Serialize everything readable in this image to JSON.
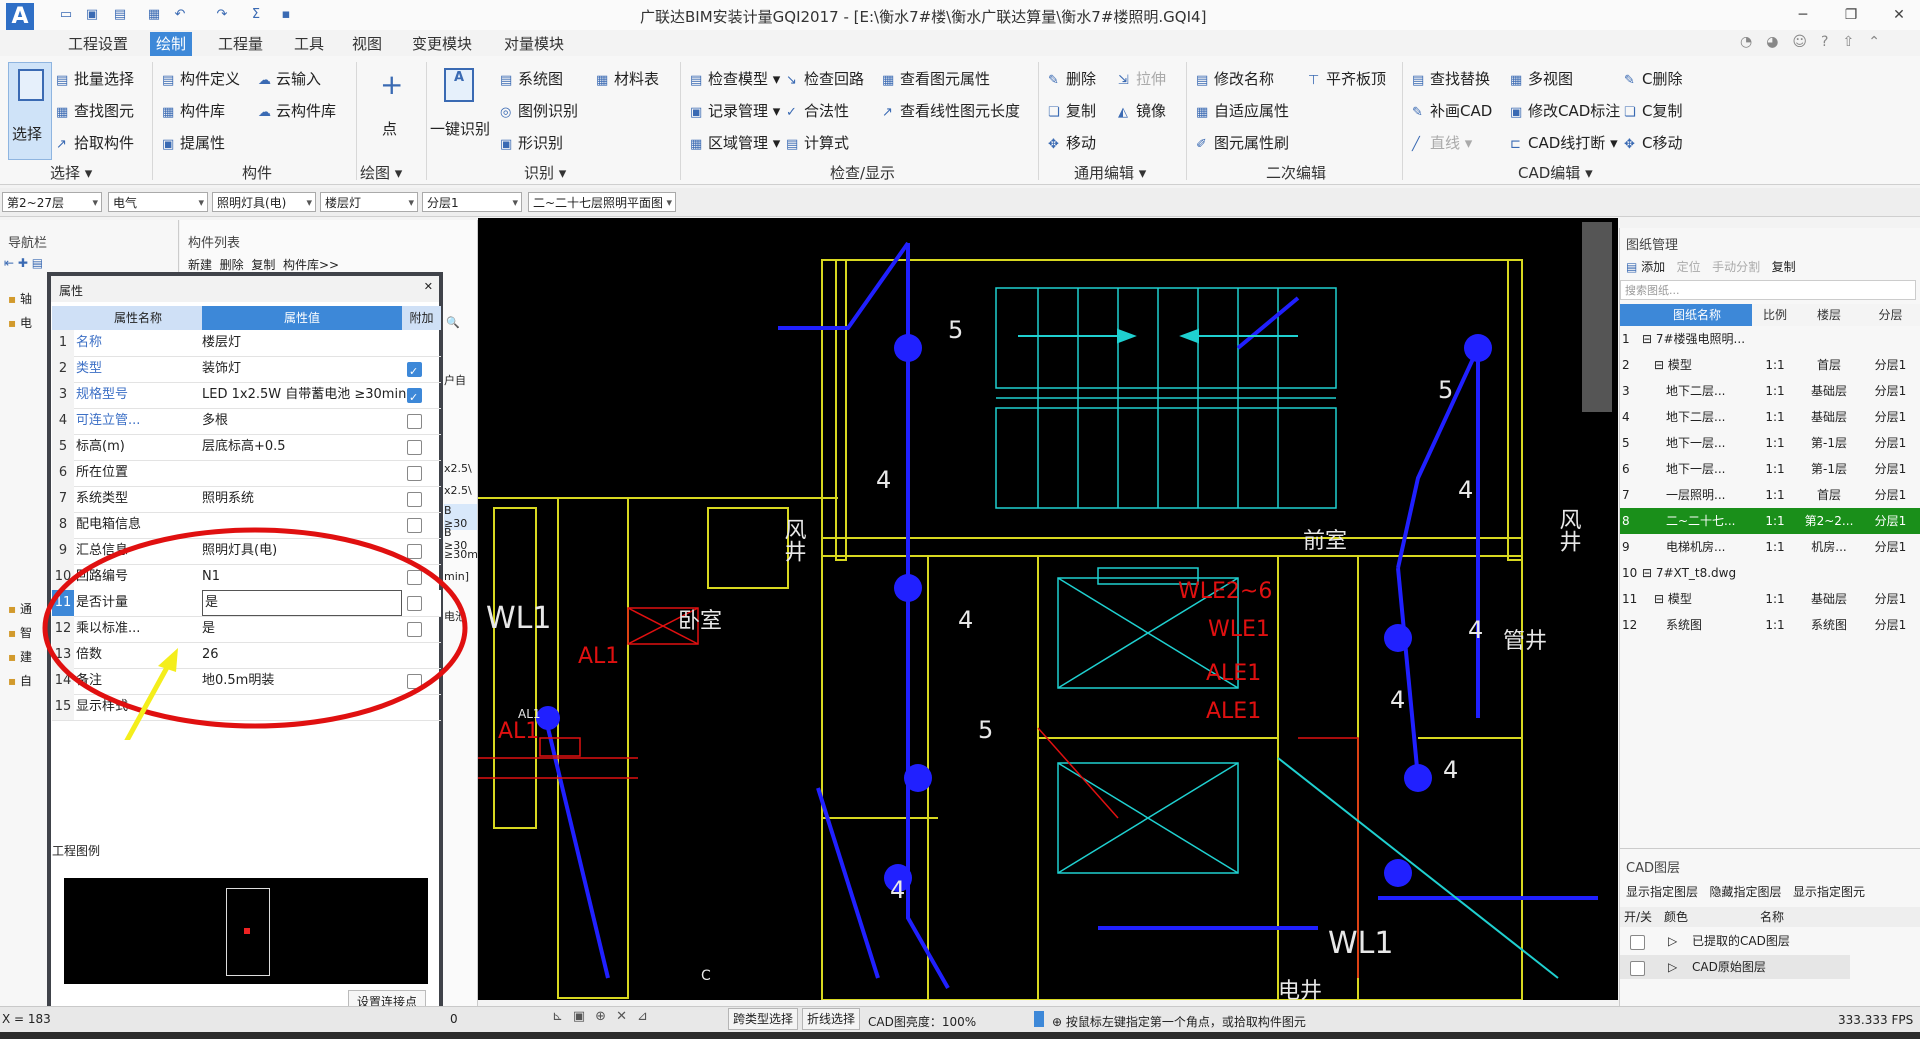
{
  "title": "广联达BIM安装计量GQI2017 - [E:\\衡水7#楼\\衡水广联达算量\\衡水7#楼照明.GQI4]",
  "menu_tabs": [
    "工程设置",
    "绘制",
    "工程量",
    "工具",
    "视图",
    "变更模块",
    "对量模块"
  ],
  "active_tab": "绘制",
  "ribbon": {
    "select_big": "选择",
    "select_items": [
      "批量选择",
      "查找图元",
      "拾取构件"
    ],
    "group_select": "选择",
    "component_items": [
      "构件定义",
      "云输入",
      "构件库",
      "云构件库",
      "提属性"
    ],
    "group_component": "构件",
    "point_label": "点",
    "group_draw": "绘图",
    "one_key": "一键识别",
    "identify_items": [
      "系统图",
      "材料表",
      "图例识别",
      "形识别"
    ],
    "group_identify": "识别",
    "check_items": [
      "检查模型",
      "检查回路",
      "查看图元属性",
      "记录管理",
      "合法性",
      "查看线性图元长度",
      "区域管理",
      "计算式"
    ],
    "group_check": "检查/显示",
    "edit_items": [
      "删除",
      "拉伸",
      "复制",
      "镜像",
      "移动"
    ],
    "group_edit": "通用编辑",
    "edit2_items": [
      "修改名称",
      "平齐板顶",
      "自适应属性",
      "图元属性刷"
    ],
    "group_edit2": "二次编辑",
    "cad_items": [
      "查找替换",
      "多视图",
      "C删除",
      "补画CAD",
      "修改CAD标注",
      "C复制",
      "直线",
      "CAD线打断",
      "C移动"
    ],
    "group_cad": "CAD编辑"
  },
  "selectors": [
    "第2~27层",
    "电气",
    "照明灯具(电)",
    "楼层灯",
    "分层1",
    "二~二十七层照明平面图"
  ],
  "nav": {
    "title": "导航栏",
    "items": [
      "轴",
      "电",
      "通",
      "智",
      "建",
      "自"
    ]
  },
  "complist": {
    "title": "构件列表",
    "toolbar": [
      "新建",
      "删除",
      "复制",
      "构件库>>"
    ],
    "side_texts": [
      "户自",
      "x2.5\\",
      "x2.5\\",
      "B ≥30",
      "B ≥30",
      "≥30m",
      "min]",
      "电池"
    ]
  },
  "property": {
    "title": "属性",
    "headers": [
      "属性名称",
      "属性值",
      "附加"
    ],
    "rows": [
      {
        "n": "1",
        "name": "名称",
        "value": "楼层灯",
        "blue": true,
        "chk": null
      },
      {
        "n": "2",
        "name": "类型",
        "value": "装饰灯",
        "blue": true,
        "chk": true
      },
      {
        "n": "3",
        "name": "规格型号",
        "value": "LED 1x2.5W 自带蓄电池 ≥30min",
        "blue": true,
        "chk": true
      },
      {
        "n": "4",
        "name": "可连立管...",
        "value": "多根",
        "blue": true,
        "chk": false
      },
      {
        "n": "5",
        "name": "标高(m)",
        "value": "层底标高+0.5",
        "blue": false,
        "chk": false
      },
      {
        "n": "6",
        "name": "所在位置",
        "value": "",
        "blue": false,
        "chk": false
      },
      {
        "n": "7",
        "name": "系统类型",
        "value": "照明系统",
        "blue": false,
        "chk": false
      },
      {
        "n": "8",
        "name": "配电箱信息",
        "value": "",
        "blue": false,
        "chk": false
      },
      {
        "n": "9",
        "name": "汇总信息",
        "value": "照明灯具(电)",
        "blue": false,
        "chk": false
      },
      {
        "n": "10",
        "name": "回路编号",
        "value": "N1",
        "blue": false,
        "chk": false
      },
      {
        "n": "11",
        "name": "是否计量",
        "value": "是",
        "blue": false,
        "chk": false
      },
      {
        "n": "12",
        "name": "乘以标准...",
        "value": "是",
        "blue": false,
        "chk": false
      },
      {
        "n": "13",
        "name": "倍数",
        "value": "26",
        "blue": false,
        "chk": null
      },
      {
        "n": "14",
        "name": "备注",
        "value": "地0.5m明装",
        "blue": false,
        "chk": false
      },
      {
        "n": "15",
        "name": "显示样式",
        "value": "",
        "blue": false,
        "chk": null
      }
    ],
    "legend_title": "工程图例",
    "connect_btn": "设置连接点"
  },
  "canvas": {
    "labels": [
      "5",
      "4",
      "4",
      "5",
      "4",
      "5",
      "4",
      "4",
      "4",
      "4",
      "风井",
      "风井",
      "前室",
      "卧室",
      "管井",
      "电井",
      "WL1",
      "WL1",
      "AL1",
      "AL1",
      "AL1",
      "WLE2~6",
      "WLE1",
      "ALE1",
      "ALE1",
      "C"
    ]
  },
  "drawings": {
    "title": "图纸管理",
    "toolbar": [
      "添加",
      "定位",
      "手动分割",
      "复制"
    ],
    "search_placeholder": "搜索图纸...",
    "headers": [
      "图纸名称",
      "比例",
      "楼层",
      "分层"
    ],
    "rows": [
      {
        "n": "1",
        "name": "⊟ 7#楼强电照明...",
        "scale": "",
        "floor": "",
        "layer": "",
        "indent": 0
      },
      {
        "n": "2",
        "name": "⊟ 模型",
        "scale": "1:1",
        "floor": "首层",
        "layer": "分层1",
        "indent": 1
      },
      {
        "n": "3",
        "name": "地下二层...",
        "scale": "1:1",
        "floor": "基础层",
        "layer": "分层1",
        "indent": 2
      },
      {
        "n": "4",
        "name": "地下二层...",
        "scale": "1:1",
        "floor": "基础层",
        "layer": "分层1",
        "indent": 2
      },
      {
        "n": "5",
        "name": "地下一层...",
        "scale": "1:1",
        "floor": "第-1层",
        "layer": "分层1",
        "indent": 2
      },
      {
        "n": "6",
        "name": "地下一层...",
        "scale": "1:1",
        "floor": "第-1层",
        "layer": "分层1",
        "indent": 2
      },
      {
        "n": "7",
        "name": "一层照明...",
        "scale": "1:1",
        "floor": "首层",
        "layer": "分层1",
        "indent": 2
      },
      {
        "n": "8",
        "name": "二~二十七...",
        "scale": "1:1",
        "floor": "第2~2...",
        "layer": "分层1",
        "indent": 2
      },
      {
        "n": "9",
        "name": "电梯机房...",
        "scale": "1:1",
        "floor": "机房...",
        "layer": "分层1",
        "indent": 2
      },
      {
        "n": "10",
        "name": "⊟ 7#XT_t8.dwg",
        "scale": "",
        "floor": "",
        "layer": "",
        "indent": 0
      },
      {
        "n": "11",
        "name": "⊟ 模型",
        "scale": "1:1",
        "floor": "基础层",
        "layer": "分层1",
        "indent": 1
      },
      {
        "n": "12",
        "name": "系统图",
        "scale": "1:1",
        "floor": "系统图",
        "layer": "分层1",
        "indent": 2
      }
    ],
    "selected_row": 7
  },
  "cad_layers": {
    "title": "CAD图层",
    "actions": [
      "显示指定图层",
      "隐藏指定图层",
      "显示指定图元"
    ],
    "headers": [
      "开/关",
      "颜色",
      "名称"
    ],
    "rows": [
      "已提取的CAD图层",
      "CAD原始图层"
    ]
  },
  "status": {
    "coord": "X = 183",
    "zero": "0",
    "buttons": [
      "跨类型选择",
      "折线选择"
    ],
    "cad_brightness": "CAD图亮度：100%",
    "hint": "按鼠标左键指定第一个角点，或拾取构件图元",
    "fps": "333.333 FPS"
  },
  "colors": {
    "accent": "#3d88d8",
    "selected_row": "#1a8f1a",
    "canvas": "#000000",
    "annotation": "#e00000"
  }
}
